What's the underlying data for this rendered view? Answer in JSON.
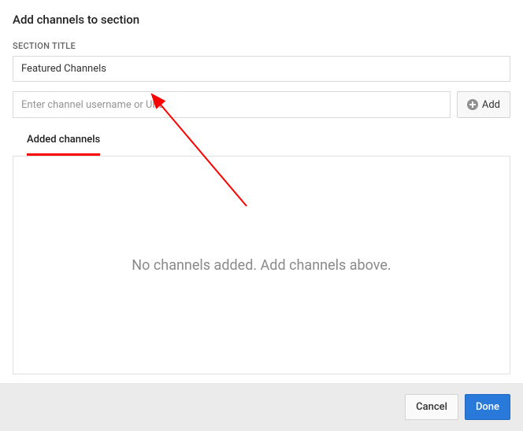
{
  "dialog": {
    "title": "Add channels to section"
  },
  "section_title": {
    "label": "SECTION TITLE",
    "value": "Featured Channels"
  },
  "channel_input": {
    "placeholder": "Enter channel username or URL",
    "value": ""
  },
  "add_button": {
    "label": "Add"
  },
  "tabs": {
    "added": "Added channels"
  },
  "empty_state": {
    "message": "No channels added. Add channels above."
  },
  "footer": {
    "cancel": "Cancel",
    "done": "Done"
  }
}
